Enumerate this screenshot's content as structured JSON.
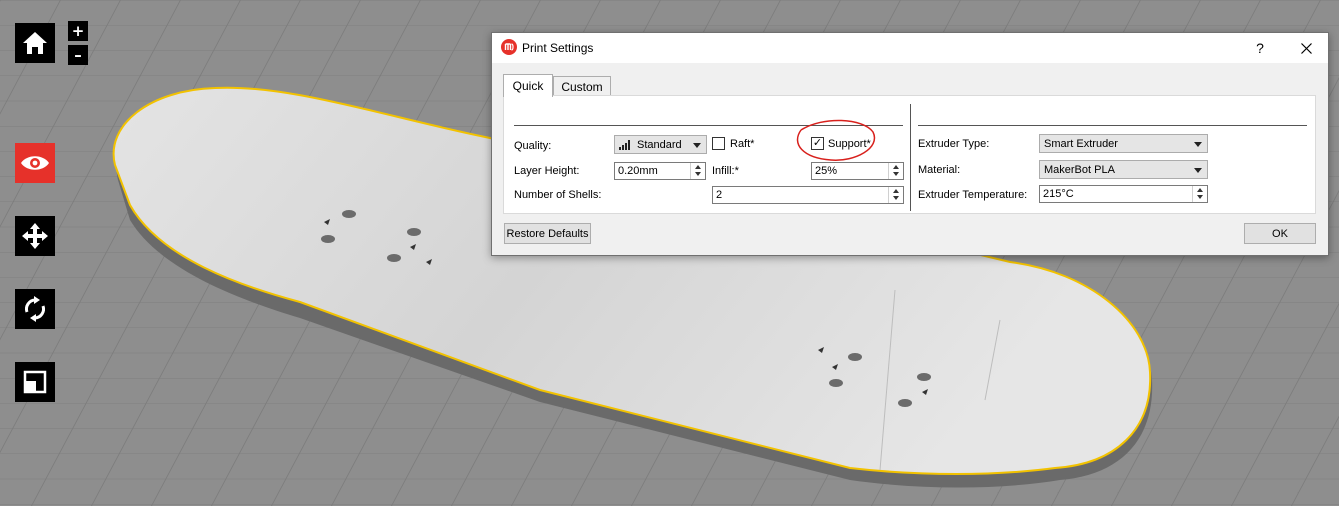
{
  "toolbar": {
    "tools": [
      {
        "name": "home",
        "icon": "home-icon"
      },
      {
        "name": "view",
        "icon": "eye-icon",
        "active": true
      },
      {
        "name": "move",
        "icon": "move-icon"
      },
      {
        "name": "rotate",
        "icon": "rotate-icon"
      },
      {
        "name": "scale",
        "icon": "scale-icon"
      }
    ],
    "zoom_in": "+",
    "zoom_out": "–"
  },
  "colors": {
    "active_tool": "#e6312a",
    "model_outline": "#f2c200",
    "annotation_circle": "#d8201c"
  },
  "dialog": {
    "title": "Print Settings",
    "help": "?",
    "close_icon": "close-icon",
    "app_icon": "makerbot-icon",
    "tabs": [
      {
        "label": "Quick",
        "selected": true
      },
      {
        "label": "Custom",
        "selected": false
      }
    ],
    "quality": {
      "label": "Quality:",
      "value": "Standard",
      "icon": "quality-bars-icon"
    },
    "raft": {
      "label": "Raft*",
      "checked": false
    },
    "support": {
      "label": "Support*",
      "checked": true
    },
    "layer_height": {
      "label": "Layer Height:",
      "value": "0.20mm"
    },
    "infill": {
      "label": "Infill:*",
      "value": "25%"
    },
    "shells": {
      "label": "Number of Shells:",
      "value": "2"
    },
    "extruder_type": {
      "label": "Extruder Type:",
      "value": "Smart Extruder"
    },
    "material": {
      "label": "Material:",
      "value": "MakerBot PLA"
    },
    "extruder_temperature": {
      "label": "Extruder Temperature:",
      "value": "215°C"
    },
    "restore_defaults": "Restore Defaults",
    "ok": "OK"
  }
}
